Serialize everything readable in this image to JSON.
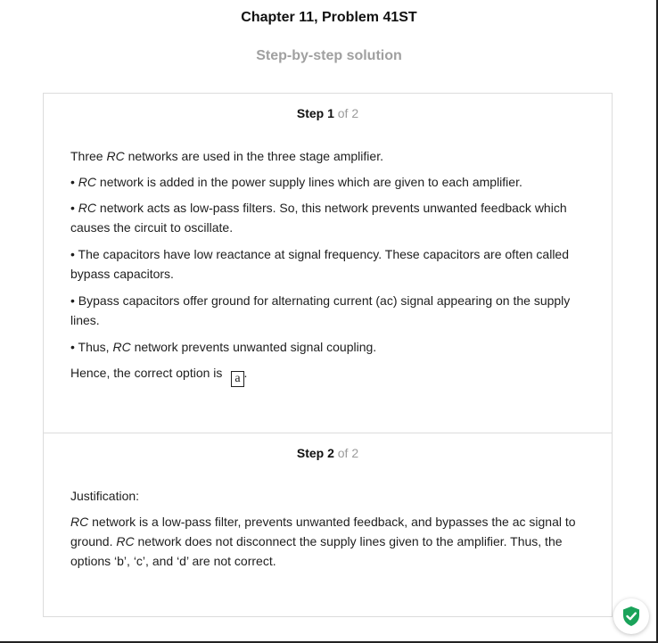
{
  "header": {
    "title": "Chapter 11, Problem 41ST",
    "subtitle": "Step-by-step solution"
  },
  "steps": [
    {
      "label": "Step 1",
      "of_text": "of 2",
      "paragraphs": [
        {
          "parts": [
            "Three ",
            "RC",
            " networks are used in the three stage amplifier."
          ]
        },
        {
          "parts": [
            "• ",
            "RC",
            " network is added in the power supply lines which are given to each amplifier."
          ]
        },
        {
          "parts": [
            "• ",
            "RC",
            " network acts as low-pass filters. So, this network prevents unwanted feedback which causes the circuit to oscillate."
          ]
        },
        {
          "text": "• The capacitors have low reactance at signal frequency. These capacitors are often called bypass capacitors."
        },
        {
          "text": "• Bypass capacitors offer ground for alternating current (ac) signal appearing on the supply lines."
        },
        {
          "parts": [
            "• Thus, ",
            "RC",
            " network prevents unwanted signal coupling."
          ]
        }
      ],
      "answer_prefix": "Hence, the correct option is",
      "answer_value": "a",
      "answer_suffix": "."
    },
    {
      "label": "Step 2",
      "of_text": "of 2",
      "paragraphs": [
        {
          "text": "Justification:"
        },
        {
          "parts": [
            "",
            "RC",
            " network is a low-pass filter, prevents unwanted feedback, and bypasses the ac signal to ground. ",
            "RC",
            " network does not disconnect the supply lines given to the amplifier. Thus, the options ‘b’, ‘c’, and ‘d’ are not correct."
          ]
        }
      ]
    }
  ],
  "badge": {
    "icon": "shield-check-icon",
    "color": "#1aa35a"
  },
  "colors": {
    "muted": "#9b9b9b",
    "border": "#dcdcdc",
    "text": "#1e1e1e"
  }
}
